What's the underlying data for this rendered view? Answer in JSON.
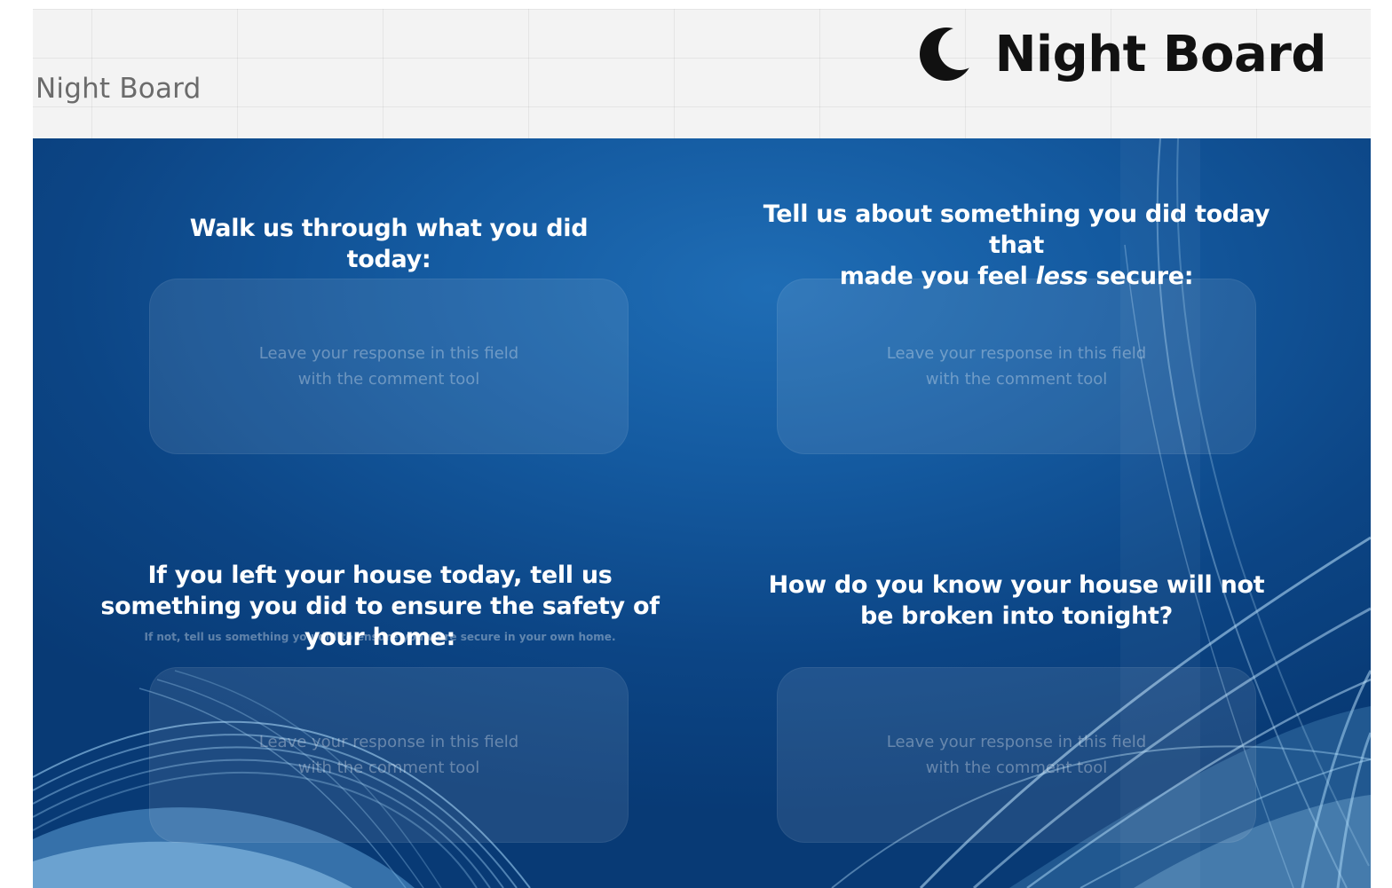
{
  "header": {
    "board_name": "Night Board",
    "logo_text": "Night Board",
    "logo_icon": "moon-icon"
  },
  "questions": [
    {
      "text": "Walk us through what you did today:",
      "placeholder": "Leave your response in this field with the comment tool"
    },
    {
      "line1": "Tell us about something you did today that",
      "line2_before": "made you feel ",
      "line2_em": "less",
      "line2_after": " secure:",
      "placeholder": "Leave your response in this field with the comment tool"
    },
    {
      "text": "If you left your house today, tell us something you did to ensure the safety of your home:",
      "subnote": "If not, tell us something you did to ensure you were secure in your own home.",
      "placeholder": "Leave your response in this field with the comment tool"
    },
    {
      "text": "How do you know your house will not be broken into tonight?",
      "placeholder": "Leave your response in this field with the comment tool"
    }
  ],
  "colors": {
    "board_blue": "#145aa0",
    "wave_light": "#9fd4f5"
  }
}
